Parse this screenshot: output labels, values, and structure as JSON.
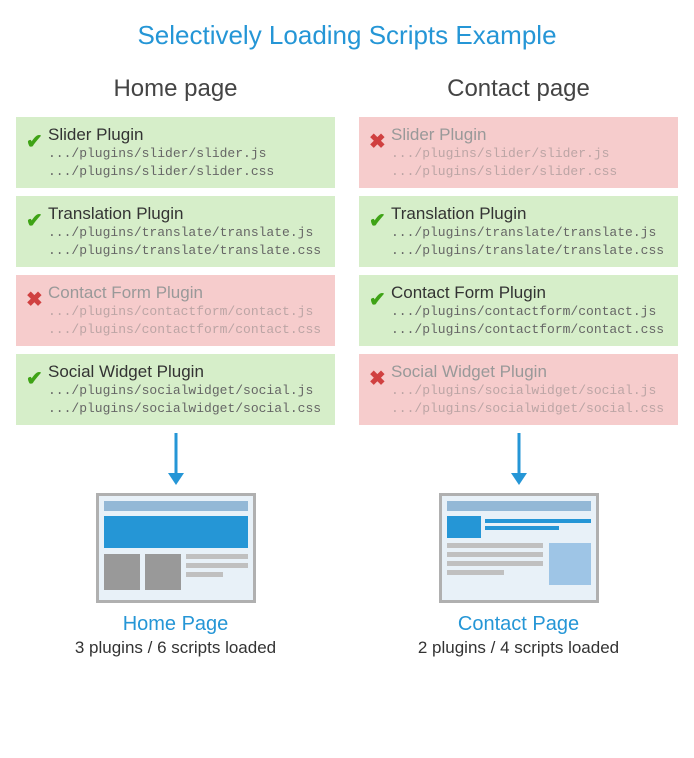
{
  "title": "Selectively Loading Scripts Example",
  "columns": [
    {
      "header": "Home page",
      "plugins": [
        {
          "enabled": true,
          "name": "Slider Plugin",
          "files": [
            ".../plugins/slider/slider.js",
            ".../plugins/slider/slider.css"
          ]
        },
        {
          "enabled": true,
          "name": "Translation Plugin",
          "files": [
            ".../plugins/translate/translate.js",
            ".../plugins/translate/translate.css"
          ]
        },
        {
          "enabled": false,
          "name": "Contact Form Plugin",
          "files": [
            ".../plugins/contactform/contact.js",
            ".../plugins/contactform/contact.css"
          ]
        },
        {
          "enabled": true,
          "name": "Social Widget Plugin",
          "files": [
            ".../plugins/socialwidget/social.js",
            ".../plugins/socialwidget/social.css"
          ]
        }
      ],
      "page_name": "Home Page",
      "stats": "3 plugins / 6 scripts loaded",
      "mockup": "home"
    },
    {
      "header": "Contact page",
      "plugins": [
        {
          "enabled": false,
          "name": "Slider Plugin",
          "files": [
            ".../plugins/slider/slider.js",
            ".../plugins/slider/slider.css"
          ]
        },
        {
          "enabled": true,
          "name": "Translation Plugin",
          "files": [
            ".../plugins/translate/translate.js",
            ".../plugins/translate/translate.css"
          ]
        },
        {
          "enabled": true,
          "name": "Contact Form Plugin",
          "files": [
            ".../plugins/contactform/contact.js",
            ".../plugins/contactform/contact.css"
          ]
        },
        {
          "enabled": false,
          "name": "Social Widget Plugin",
          "files": [
            ".../plugins/socialwidget/social.js",
            ".../plugins/socialwidget/social.css"
          ]
        }
      ],
      "page_name": "Contact Page",
      "stats": "2 plugins / 4 scripts loaded",
      "mockup": "contact"
    }
  ]
}
